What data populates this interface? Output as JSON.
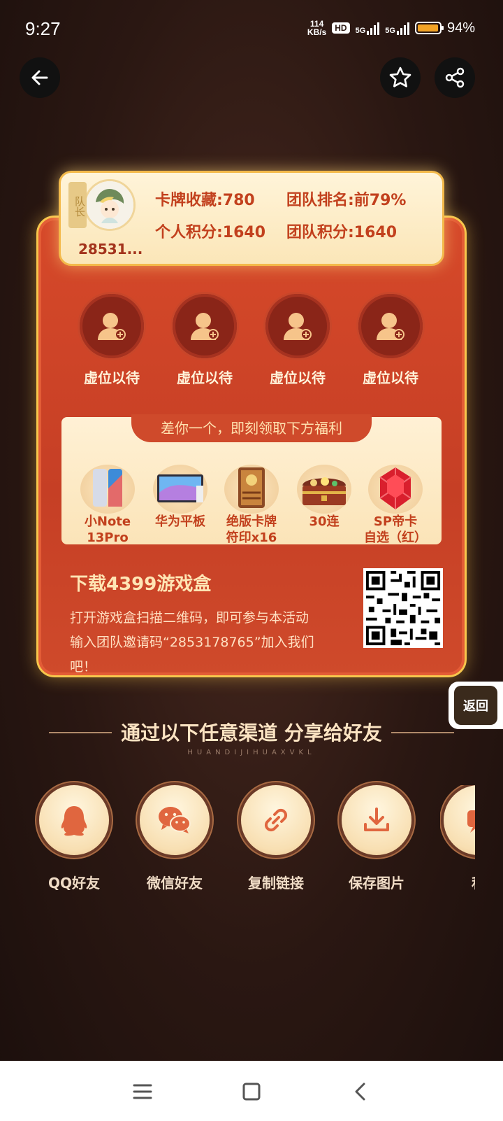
{
  "status_bar": {
    "time": "9:27",
    "net_speed_value": "114",
    "net_speed_unit": "KB/s",
    "hd": "HD",
    "sig1": "5G",
    "sig2": "5G",
    "battery": "94%",
    "battery_level": 0.94
  },
  "header": {
    "back_icon": "arrow-left-icon",
    "favorite_icon": "star-icon",
    "share_icon": "share-icon"
  },
  "team_card": {
    "leader_tag": "队长",
    "user_id": "28531...",
    "card_collection": "卡牌收藏:780",
    "team_rank": "团队排名:前79%",
    "personal_points": "个人积分:1640",
    "team_points": "团队积分:1640",
    "slots": [
      {
        "label": "虚位以待"
      },
      {
        "label": "虚位以待"
      },
      {
        "label": "虚位以待"
      },
      {
        "label": "虚位以待"
      }
    ]
  },
  "rewards": {
    "banner": "差你一个，即刻领取下方福利",
    "items": [
      {
        "line1": "小Note",
        "line2": "13Pro"
      },
      {
        "line1": "华为平板",
        "line2": ""
      },
      {
        "line1": "绝版卡牌",
        "line2": "符印x16"
      },
      {
        "line1": "30连",
        "line2": ""
      },
      {
        "line1": "SP帝卡",
        "line2": "自选（红）"
      }
    ]
  },
  "download": {
    "title": "下载4399游戏盒",
    "line1": "打开游戏盒扫描二维码，即可参与本活动",
    "line2": "输入团队邀请码“2853178765”加入我们",
    "line3": "吧！"
  },
  "return_button": "返回",
  "share": {
    "title": "通过以下任意渠道  分享给好友",
    "subtitle": "HUANDIJIHUAXVKL",
    "items": [
      {
        "label": "QQ好友",
        "icon": "qq-icon"
      },
      {
        "label": "微信好友",
        "icon": "wechat-icon"
      },
      {
        "label": "复制链接",
        "icon": "link-icon"
      },
      {
        "label": "保存图片",
        "icon": "download-icon"
      },
      {
        "label": "私",
        "icon": "message-icon"
      }
    ]
  },
  "nav": {
    "menu_icon": "menu-icon",
    "home_icon": "home-icon",
    "back_icon": "back-icon"
  }
}
